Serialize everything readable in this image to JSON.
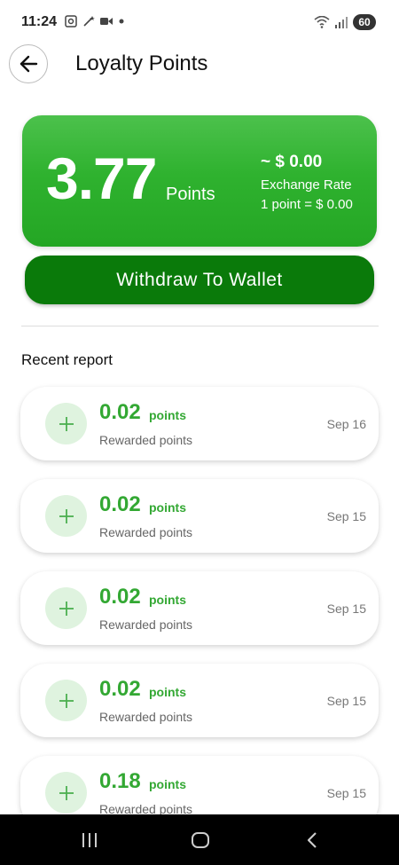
{
  "status_bar": {
    "time": "11:24",
    "battery": "60"
  },
  "header": {
    "title": "Loyalty Points"
  },
  "points_card": {
    "value": "3.77",
    "unit": "Points",
    "approx_value": "~ $ 0.00",
    "rate_label": "Exchange Rate",
    "rate_value": "1 point = $ 0.00"
  },
  "withdraw_button": {
    "label": "Withdraw To Wallet"
  },
  "recent": {
    "title": "Recent report",
    "items": [
      {
        "amount": "0.02",
        "unit": "points",
        "desc": "Rewarded points",
        "date": "Sep 16"
      },
      {
        "amount": "0.02",
        "unit": "points",
        "desc": "Rewarded points",
        "date": "Sep 15"
      },
      {
        "amount": "0.02",
        "unit": "points",
        "desc": "Rewarded points",
        "date": "Sep 15"
      },
      {
        "amount": "0.02",
        "unit": "points",
        "desc": "Rewarded points",
        "date": "Sep 15"
      },
      {
        "amount": "0.18",
        "unit": "points",
        "desc": "Rewarded points",
        "date": "Sep 15"
      }
    ]
  },
  "colors": {
    "card_green": "#2fb22f",
    "button_green": "#0a7a0a",
    "amount_green": "#33a833",
    "icon_bg": "#dff3df"
  },
  "icons": {
    "back": "arrow-left-icon",
    "plus": "plus-icon",
    "nav_recents": "recents-icon",
    "nav_home": "home-icon",
    "nav_back": "back-chevron-icon"
  }
}
